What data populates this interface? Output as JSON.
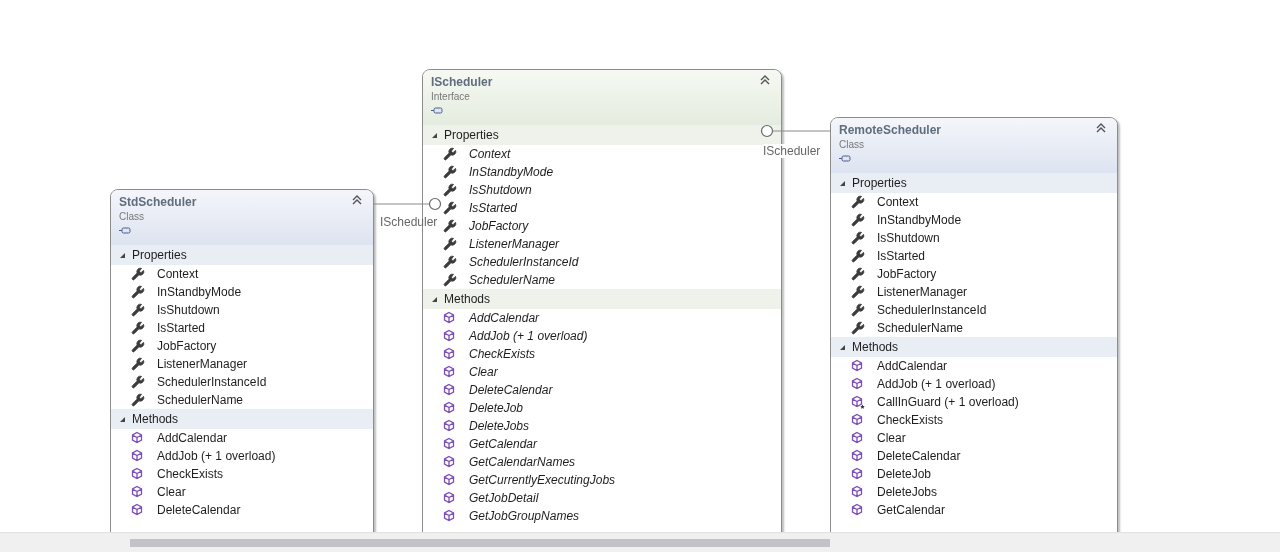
{
  "nodes": [
    {
      "name": "StdScheduler",
      "kind": "class",
      "kind_label": "Class",
      "collapsed": false,
      "interface_label": "IScheduler",
      "sections": [
        {
          "title": "Properties",
          "expanded": true,
          "members": [
            {
              "name": "Context",
              "kind": "property"
            },
            {
              "name": "InStandbyMode",
              "kind": "property"
            },
            {
              "name": "IsShutdown",
              "kind": "property"
            },
            {
              "name": "IsStarted",
              "kind": "property"
            },
            {
              "name": "JobFactory",
              "kind": "property"
            },
            {
              "name": "ListenerManager",
              "kind": "property"
            },
            {
              "name": "SchedulerInstanceId",
              "kind": "property"
            },
            {
              "name": "SchedulerName",
              "kind": "property"
            }
          ]
        },
        {
          "title": "Methods",
          "expanded": true,
          "members": [
            {
              "name": "AddCalendar",
              "kind": "method"
            },
            {
              "name": "AddJob (+ 1 overload)",
              "kind": "method"
            },
            {
              "name": "CheckExists",
              "kind": "method"
            },
            {
              "name": "Clear",
              "kind": "method"
            },
            {
              "name": "DeleteCalendar",
              "kind": "method"
            }
          ]
        }
      ]
    },
    {
      "name": "IScheduler",
      "kind": "interface",
      "kind_label": "Interface",
      "collapsed": false,
      "sections": [
        {
          "title": "Properties",
          "expanded": true,
          "members": [
            {
              "name": "Context",
              "kind": "property"
            },
            {
              "name": "InStandbyMode",
              "kind": "property"
            },
            {
              "name": "IsShutdown",
              "kind": "property"
            },
            {
              "name": "IsStarted",
              "kind": "property"
            },
            {
              "name": "JobFactory",
              "kind": "property"
            },
            {
              "name": "ListenerManager",
              "kind": "property"
            },
            {
              "name": "SchedulerInstanceId",
              "kind": "property"
            },
            {
              "name": "SchedulerName",
              "kind": "property"
            }
          ]
        },
        {
          "title": "Methods",
          "expanded": true,
          "members": [
            {
              "name": "AddCalendar",
              "kind": "method"
            },
            {
              "name": "AddJob (+ 1 overload)",
              "kind": "method"
            },
            {
              "name": "CheckExists",
              "kind": "method"
            },
            {
              "name": "Clear",
              "kind": "method"
            },
            {
              "name": "DeleteCalendar",
              "kind": "method"
            },
            {
              "name": "DeleteJob",
              "kind": "method"
            },
            {
              "name": "DeleteJobs",
              "kind": "method"
            },
            {
              "name": "GetCalendar",
              "kind": "method"
            },
            {
              "name": "GetCalendarNames",
              "kind": "method"
            },
            {
              "name": "GetCurrentlyExecutingJobs",
              "kind": "method"
            },
            {
              "name": "GetJobDetail",
              "kind": "method"
            },
            {
              "name": "GetJobGroupNames",
              "kind": "method"
            }
          ]
        }
      ]
    },
    {
      "name": "RemoteScheduler",
      "kind": "class",
      "kind_label": "Class",
      "collapsed": false,
      "interface_label": "IScheduler",
      "sections": [
        {
          "title": "Properties",
          "expanded": true,
          "members": [
            {
              "name": "Context",
              "kind": "property"
            },
            {
              "name": "InStandbyMode",
              "kind": "property"
            },
            {
              "name": "IsShutdown",
              "kind": "property"
            },
            {
              "name": "IsStarted",
              "kind": "property"
            },
            {
              "name": "JobFactory",
              "kind": "property"
            },
            {
              "name": "ListenerManager",
              "kind": "property"
            },
            {
              "name": "SchedulerInstanceId",
              "kind": "property"
            },
            {
              "name": "SchedulerName",
              "kind": "property"
            }
          ]
        },
        {
          "title": "Methods",
          "expanded": true,
          "members": [
            {
              "name": "AddCalendar",
              "kind": "method"
            },
            {
              "name": "AddJob (+ 1 overload)",
              "kind": "method"
            },
            {
              "name": "CallInGuard (+ 1 overload)",
              "kind": "protected_method"
            },
            {
              "name": "CheckExists",
              "kind": "method"
            },
            {
              "name": "Clear",
              "kind": "method"
            },
            {
              "name": "DeleteCalendar",
              "kind": "method"
            },
            {
              "name": "DeleteJob",
              "kind": "method"
            },
            {
              "name": "DeleteJobs",
              "kind": "method"
            },
            {
              "name": "GetCalendar",
              "kind": "method"
            }
          ]
        }
      ]
    }
  ]
}
